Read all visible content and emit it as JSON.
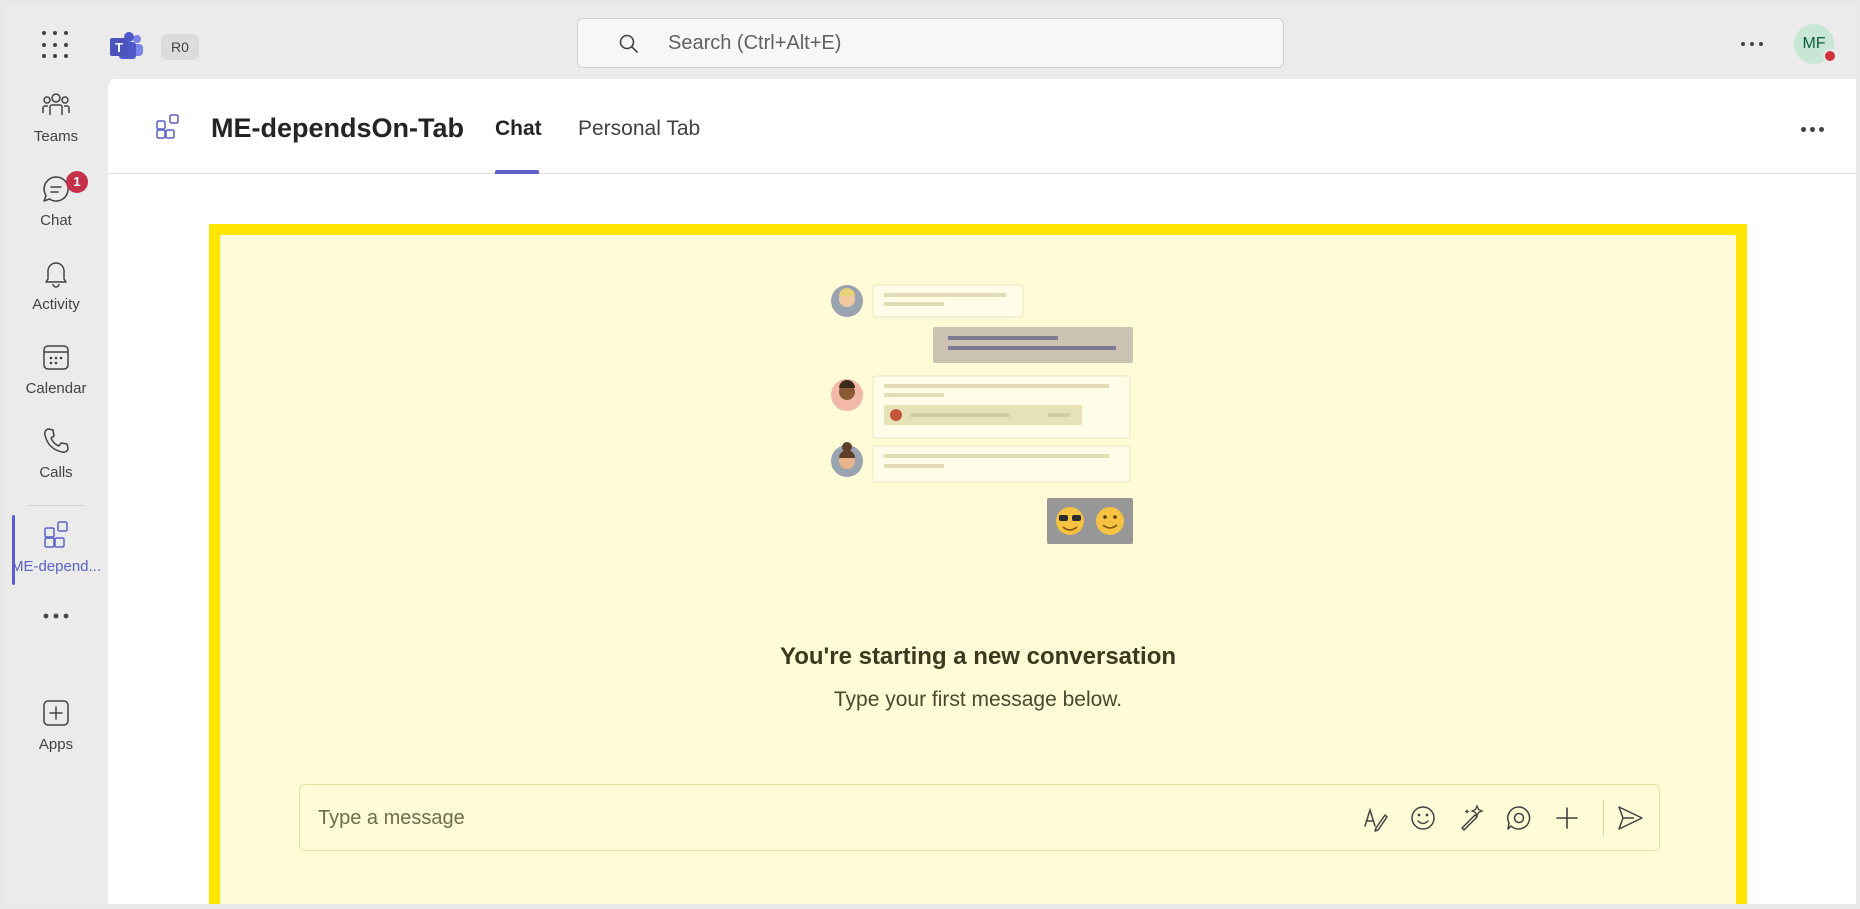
{
  "topbar": {
    "apps_icon": "waffle-grid-icon",
    "logo": "microsoft-teams-logo",
    "org_badge": "R0",
    "search_placeholder": "Search (Ctrl+Alt+E)",
    "more_icon": "more-horizontal-icon",
    "avatar_initials": "MF",
    "presence": "busy"
  },
  "rail": {
    "items": [
      {
        "label": "Teams",
        "icon": "teams-icon"
      },
      {
        "label": "Chat",
        "icon": "chat-icon",
        "badge": "1"
      },
      {
        "label": "Activity",
        "icon": "bell-icon"
      },
      {
        "label": "Calendar",
        "icon": "calendar-icon"
      },
      {
        "label": "Calls",
        "icon": "phone-icon"
      },
      {
        "label": "ME-depend...",
        "icon": "app-grid-icon",
        "active": true
      },
      {
        "label": "",
        "icon": "more-horizontal-icon"
      },
      {
        "label": "Apps",
        "icon": "add-apps-icon"
      }
    ]
  },
  "header": {
    "title": "ME-dependsOn-Tab",
    "tabs": [
      {
        "label": "Chat",
        "active": true
      },
      {
        "label": "Personal Tab",
        "active": false
      }
    ]
  },
  "content": {
    "empty_title": "You're starting a new conversation",
    "empty_subtitle": "Type your first message below.",
    "compose_placeholder": "Type a message",
    "compose_buttons": [
      "format-icon",
      "emoji-icon",
      "copilot-sparkle-icon",
      "loop-icon",
      "attach-plus-icon",
      "send-icon"
    ]
  },
  "colors": {
    "accent": "#5b5fc7",
    "highlight_border": "#ffe600",
    "highlight_fill": "#fffbd6",
    "badge": "#c4314b"
  }
}
